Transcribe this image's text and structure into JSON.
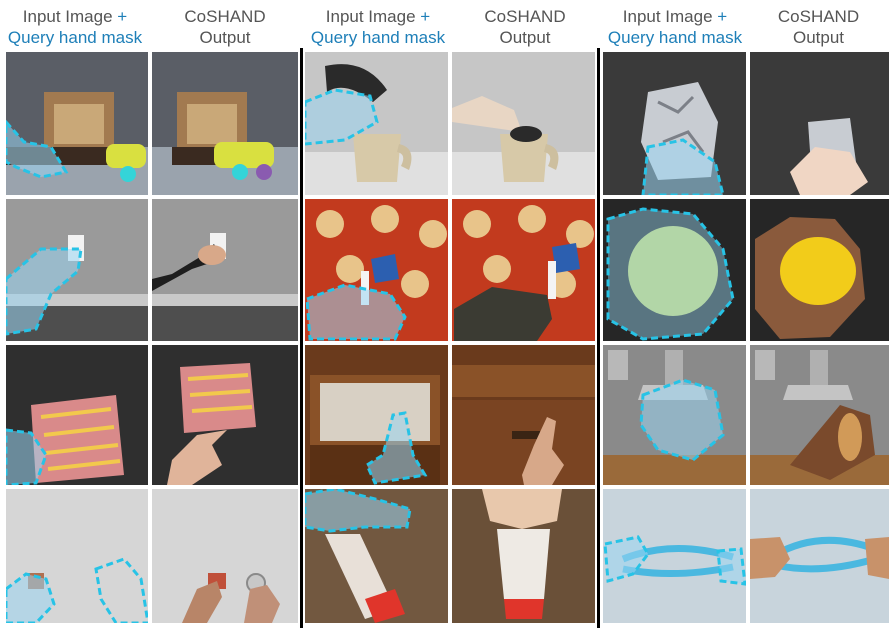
{
  "headers": {
    "input_label_part1": "Input Image",
    "input_label_plus": "+",
    "input_label_part2": "Query hand mask",
    "output_label_line1": "CoSHAND",
    "output_label_line2": "Output"
  },
  "colors": {
    "header_text": "#555555",
    "accent_blue": "#1e7fb8",
    "mask_outline": "#27c3e6",
    "mask_fill": "#9ad6f2",
    "separator": "#000000"
  }
}
